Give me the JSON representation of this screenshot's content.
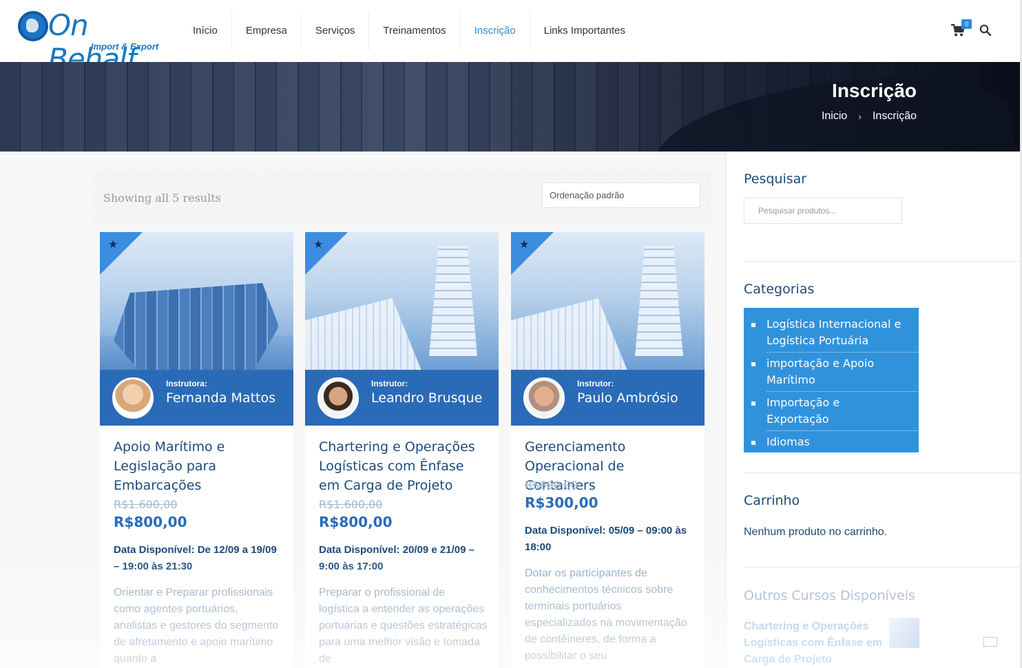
{
  "header": {
    "logo_text": "On Behalf",
    "logo_sub": "Import & Export",
    "nav": [
      "Início",
      "Empresa",
      "Serviços",
      "Treinamentos",
      "Inscrição",
      "Links Importantes"
    ],
    "cart_count": "0",
    "accent_color": "#2d8ad6"
  },
  "banner": {
    "title": "Inscrição",
    "breadcrumb": [
      "Inicio",
      "Inscrição"
    ]
  },
  "shop": {
    "results_count": "Showing all 5 results",
    "ordering": "Ordenação padrão",
    "products": [
      {
        "instructor_role": "Instrutora:",
        "instructor_name": "Fernanda Mattos",
        "title": "Apoio Marítimo e Legislação para Embarcações",
        "old_price": "R$1.600,00",
        "price": "R$800,00",
        "date": "Data Disponível: De 12/09 a 19/09 – 19:00 às 21:30",
        "description": "Orientar e Preparar profissionais como agentes portuários, analistas e gestores do segmento de afretamento e apoio marítimo quanto a"
      },
      {
        "instructor_role": "Instrutor:",
        "instructor_name": "Leandro Brusque",
        "title": "Chartering e Operações Logísticas com Ênfase em Carga de Projeto",
        "old_price": "R$1.600,00",
        "price": "R$800,00",
        "date": "Data Disponível: 20/09 e 21/09 – 9:00 às 17:00",
        "description": "Preparar o profissional de logística a entender as operações portuárias e questões estratégicas para uma melhor visão e tomada de"
      },
      {
        "instructor_role": "Instrutor:",
        "instructor_name": "Paulo Ambrósio",
        "title": "Gerenciamento Operacional de Containers",
        "old_price": "R$600,00",
        "price": "R$300,00",
        "date": "Data Disponível: 05/09 – 09:00 às 18:00",
        "description": "Dotar os participantes de conhecimentos técnicos sobre terminais portuários especializados na movimentação de contêineres, de forma a possibilitar o seu"
      }
    ]
  },
  "sidebar": {
    "search_title": "Pesquisar",
    "search_placeholder": "Pesquisar produtos...",
    "categories_title": "Categorias",
    "categories": [
      "Logística Internacional e Logística Portuária",
      "importação e Apoio Marítimo",
      "Importação e Exportação",
      "Idiomas"
    ],
    "cart_title": "Carrinho",
    "cart_empty": "Nenhum produto no carrinho.",
    "other_title": "Outros Cursos Disponíveis",
    "other_link": "Chartering e Operações Logísticas com Ênfase em Carga de Projeto"
  }
}
